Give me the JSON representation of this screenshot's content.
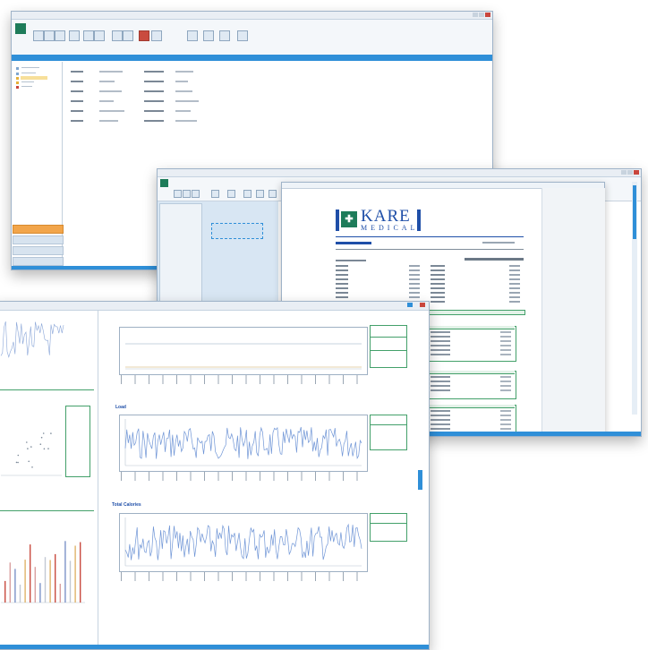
{
  "logo": {
    "brand_top": "KARE",
    "brand_bottom": "MEDICAL"
  },
  "graph_titles": {
    "load": "Load",
    "total_calories": "Total Calories"
  },
  "colors": {
    "accent_blue": "#2f8fd8",
    "brand_green": "#1e7c5a",
    "brand_navy": "#1f4fa8",
    "section_green": "#43a06a",
    "nav_active": "#f2a54a",
    "chart_line": "#6f95d6"
  },
  "icons": [
    "app-logo-icon",
    "close-icon",
    "kare-medical-logo"
  ]
}
